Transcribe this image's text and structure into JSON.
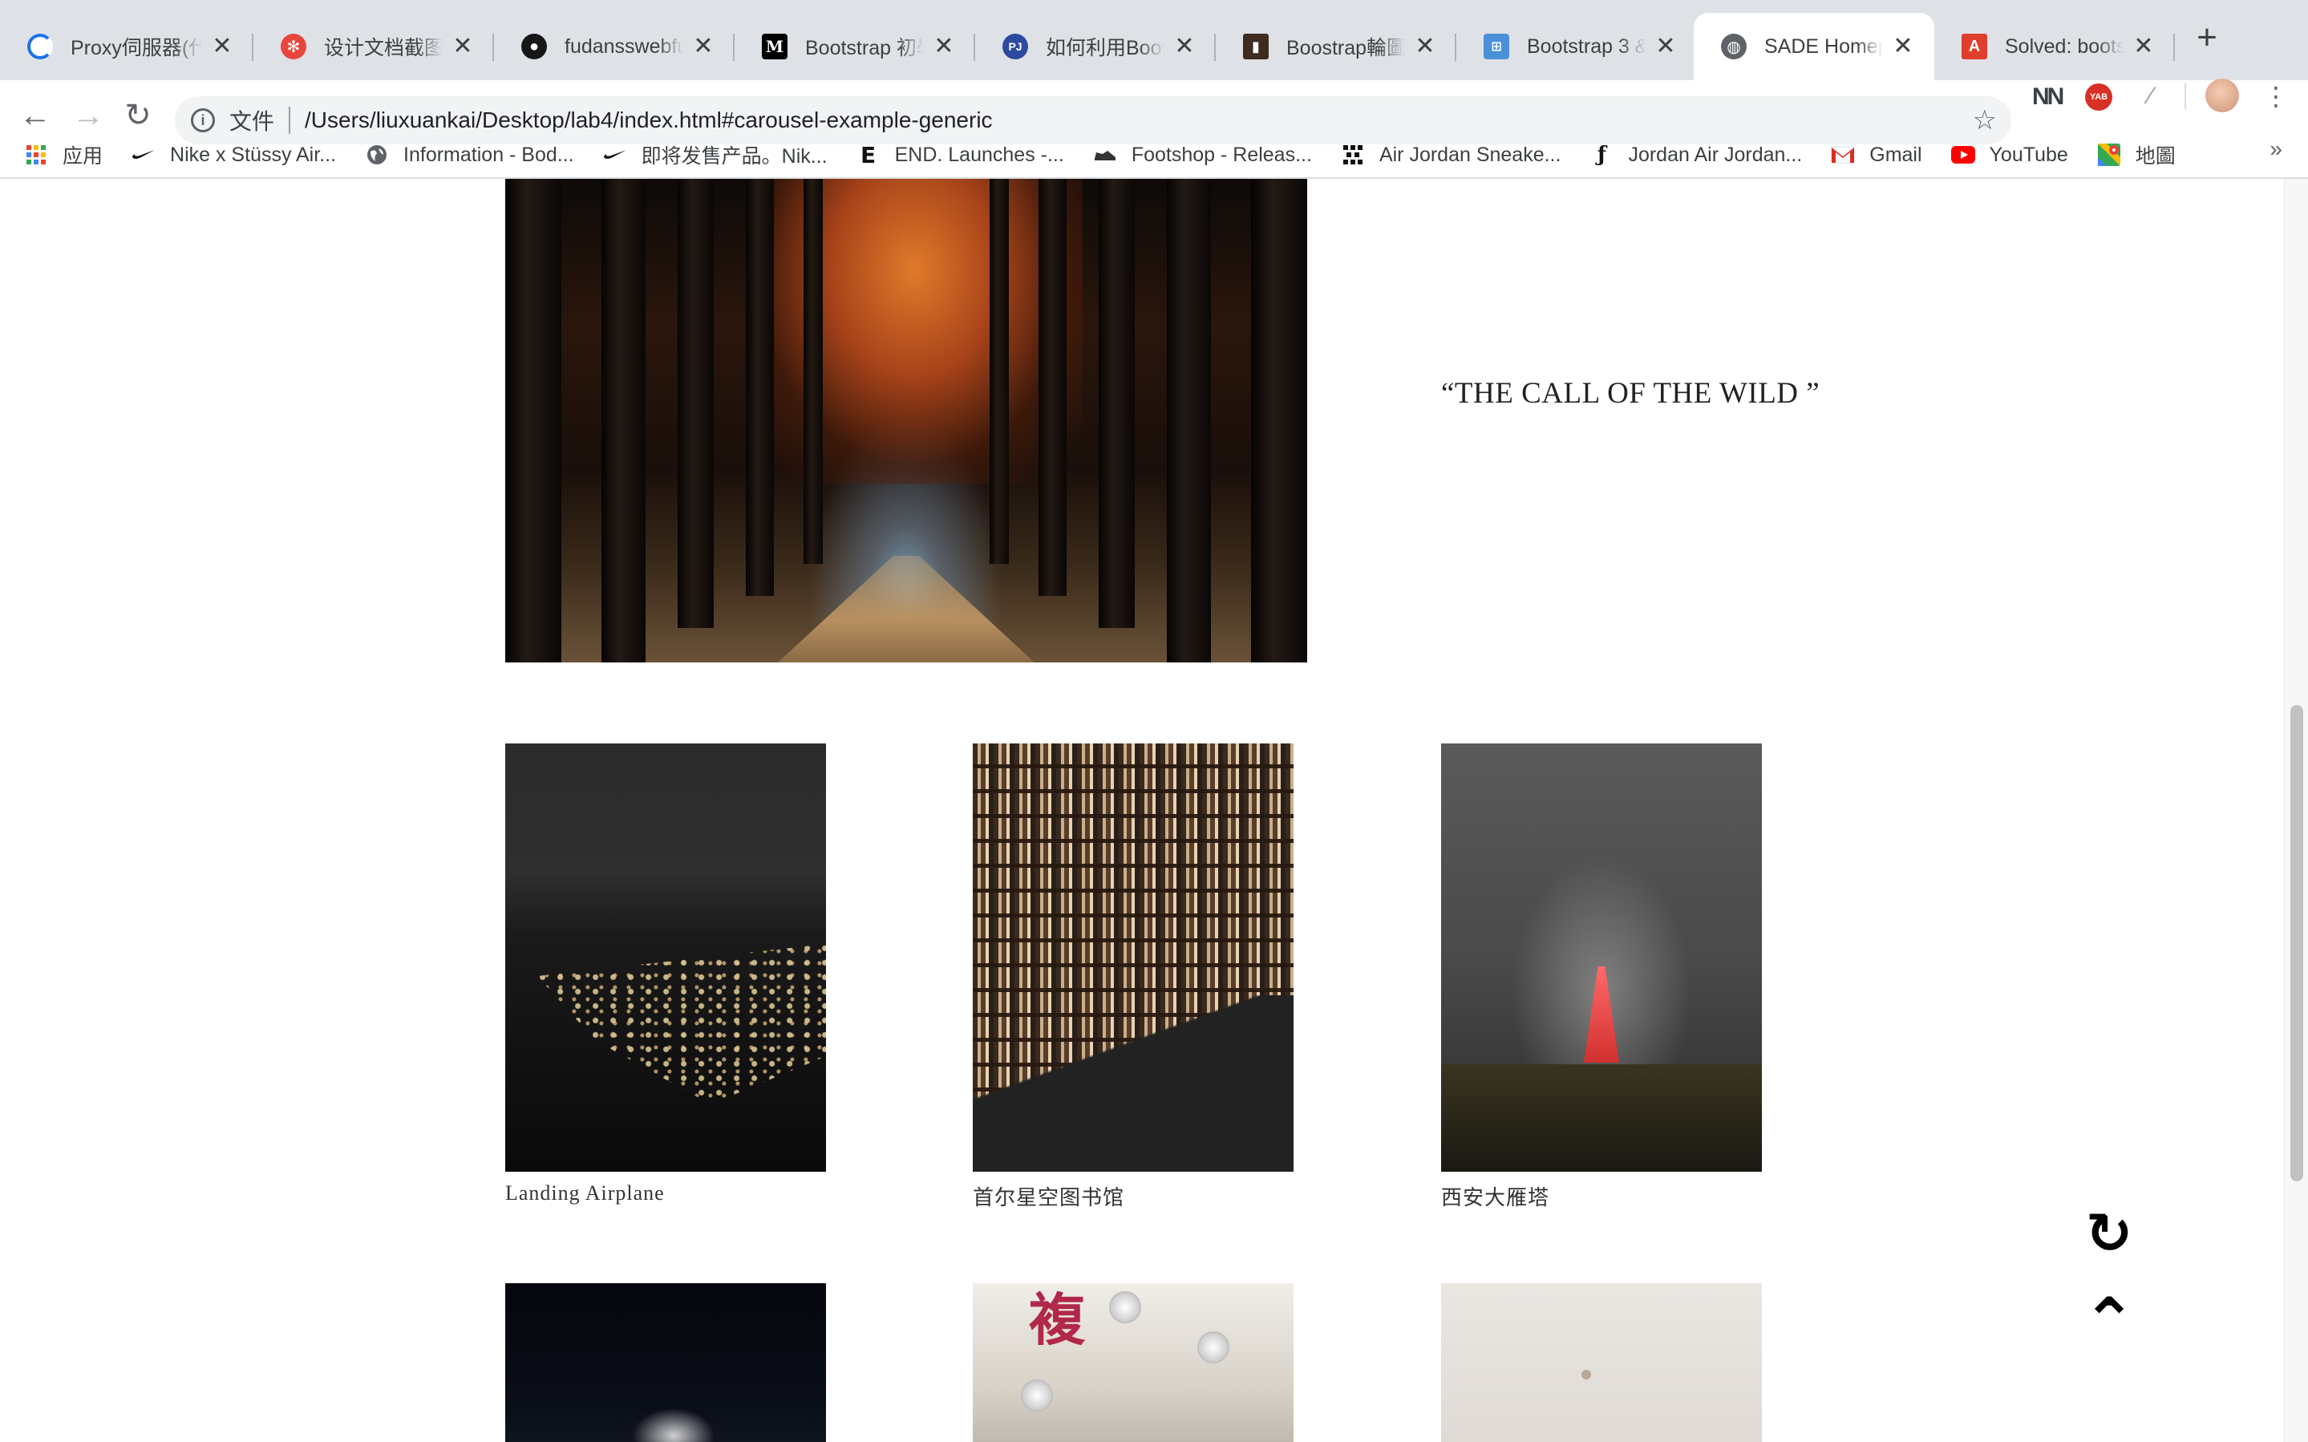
{
  "tabs": [
    {
      "title": "Proxy伺服器(代",
      "favicon": "proxy-icon",
      "color": "#1a73e8"
    },
    {
      "title": "设计文档截图提",
      "favicon": "gear-badge-icon",
      "color": "#e8453c"
    },
    {
      "title": "fudansswebfun",
      "favicon": "github-icon",
      "color": "#181717"
    },
    {
      "title": "Bootstrap 初學",
      "favicon": "medium-icon",
      "color": "#000000"
    },
    {
      "title": "如何利用Bootst",
      "favicon": "pj-icon",
      "color": "#2b4aa0"
    },
    {
      "title": "Boostrap輪圖片",
      "favicon": "block-icon",
      "color": "#3d2b1f"
    },
    {
      "title": "Bootstrap 3 & ",
      "favicon": "sitemap-icon",
      "color": "#4a90d9"
    },
    {
      "title": "SADE Homepag",
      "favicon": "globe-icon",
      "color": "#5f6368",
      "active": true
    },
    {
      "title": "Solved: bootstr",
      "favicon": "adobe-icon",
      "color": "#e03e2d"
    }
  ],
  "toolbar": {
    "security_chip": "文件",
    "url": "/Users/liuxuankai/Desktop/lab4/index.html#carousel-example-generic"
  },
  "bookmarks": [
    {
      "label": "应用",
      "icon": "apps-grid-icon"
    },
    {
      "label": "Nike x Stüssy Air...",
      "icon": "nike-swoosh-icon"
    },
    {
      "label": "Information - Bod...",
      "icon": "globe-icon"
    },
    {
      "label": "即将发售产品。Nik...",
      "icon": "nike-swoosh-icon"
    },
    {
      "label": "END. Launches -...",
      "icon": "end-logo-icon"
    },
    {
      "label": "Footshop - Releas...",
      "icon": "sneaker-icon"
    },
    {
      "label": "Air Jordan Sneake...",
      "icon": "pixel-logo-icon"
    },
    {
      "label": "Jordan Air Jordan...",
      "icon": "f-logo-icon"
    },
    {
      "label": "Gmail",
      "icon": "gmail-icon"
    },
    {
      "label": "YouTube",
      "icon": "youtube-icon"
    },
    {
      "label": "地圖",
      "icon": "maps-icon"
    }
  ],
  "page": {
    "quote": "“THE CALL OF THE WILD ”",
    "gallery": [
      {
        "caption": "Landing Airplane"
      },
      {
        "caption": "首尔星空图书馆"
      },
      {
        "caption": "西安大雁塔"
      }
    ]
  },
  "float_buttons": {
    "refresh_glyph": "↻",
    "top_glyph": "⌃"
  }
}
